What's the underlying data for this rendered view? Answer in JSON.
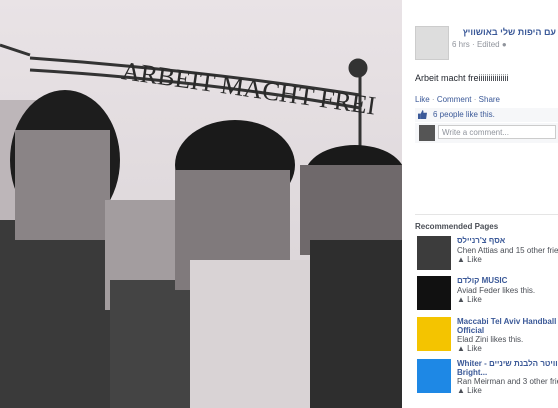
{
  "post": {
    "page_name": "עם היפות שלי באושוויץ",
    "time": "6 hrs",
    "separator": "·",
    "edited": "Edited",
    "text": "Arbeit macht freiiiiiiiiiiiiiii",
    "actions": [
      "Like",
      "Comment",
      "Share"
    ],
    "likes": "6 people like this.",
    "comment_placeholder": "Write a comment..."
  },
  "photo": {
    "sign_text": "ARBEIT MACHT FREI"
  },
  "recommended": {
    "title": "Recommended Pages",
    "like_label": "Like",
    "items": [
      {
        "name": "אסף צ'רניילס",
        "sub": "Chen Attias and 15 other frie"
      },
      {
        "name": "קולדם MUSIC",
        "sub": "Aviad Feder likes this."
      },
      {
        "name": "Maccabi Tel Aviv Handball",
        "name2": "Official",
        "sub": "Elad Zini likes this."
      },
      {
        "name": "וויטר הלבנת שיניים - Whiter",
        "name2": "Bright...",
        "sub": "Ran Meirman and 3 other frie"
      }
    ]
  },
  "colors": {
    "link": "#3b5998",
    "panel_bg": "#ffffff",
    "photo_bg": "#000000"
  }
}
